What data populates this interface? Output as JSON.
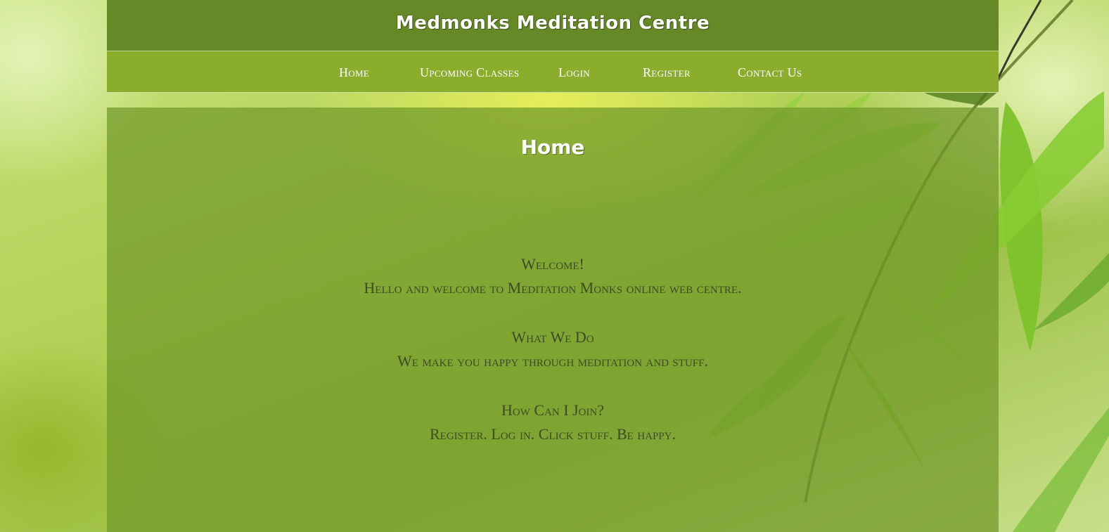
{
  "site": {
    "title": "Medmonks Meditation Centre"
  },
  "nav": {
    "items": [
      {
        "label": "Home"
      },
      {
        "label": "Upcoming Classes"
      },
      {
        "label": "Login"
      },
      {
        "label": "Register"
      },
      {
        "label": "Contact Us"
      }
    ]
  },
  "main": {
    "heading": "Home",
    "sections": [
      {
        "title": "Welcome!",
        "text": "Hello and welcome to Meditation Monks online web centre."
      },
      {
        "title": "What We Do",
        "text": "We make you happy through meditation and stuff."
      },
      {
        "title": "How Can I Join?",
        "text": "Register. Log in. Click stuff. Be happy."
      }
    ]
  },
  "colors": {
    "header": "#648926",
    "nav": "#8aae2c",
    "content_overlay": "#709828",
    "text_dark": "#3e4a22",
    "text_light": "#ffffff"
  }
}
